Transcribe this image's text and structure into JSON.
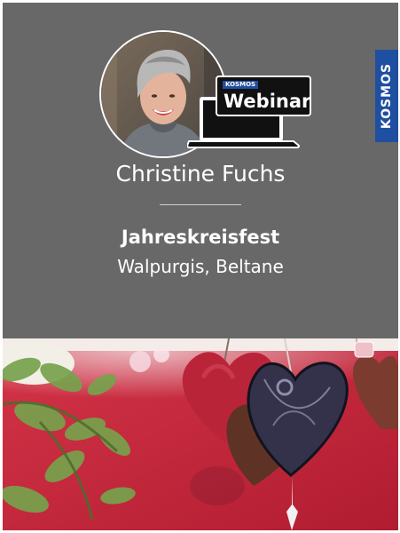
{
  "brand": {
    "name": "KOSMOS",
    "color": "#1f4fa0"
  },
  "badge": {
    "small": "KOSMOS",
    "label": "Webinar"
  },
  "presenter": {
    "name": "Christine Fuchs"
  },
  "event": {
    "title": "Jahreskreisfest",
    "subtitle": "Walpurgis, Beltane"
  },
  "icons": {
    "laptop": "laptop-icon",
    "photo": "hearts-photo"
  },
  "colors": {
    "background": "#686868",
    "accent": "#1f4fa0",
    "photo_red": "#c8273c"
  }
}
